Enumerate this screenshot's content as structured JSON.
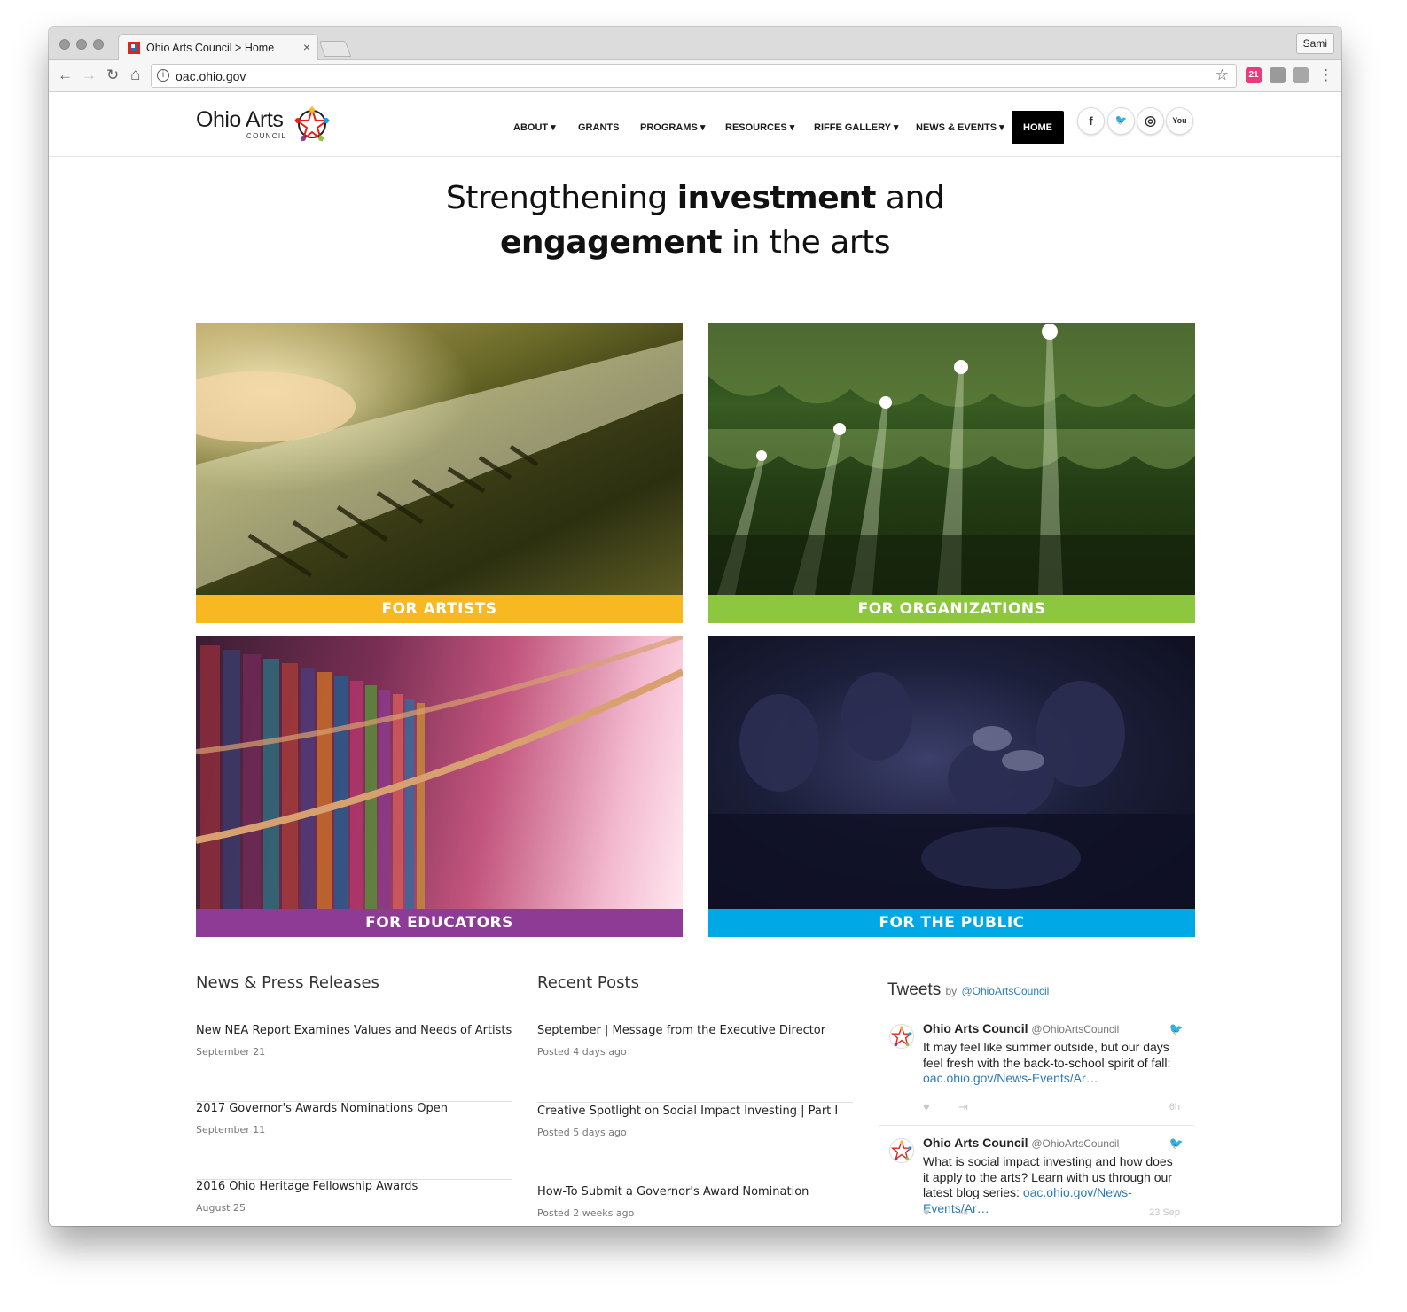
{
  "browser": {
    "tab_title": "Ohio Arts Council > Home",
    "tab_close": "×",
    "profile": "Sami",
    "url": "oac.ohio.gov",
    "back": "←",
    "forward": "→",
    "reload": "↻",
    "home": "⌂",
    "info": "i",
    "star": "☆",
    "menu": "⋮",
    "ext_badge": "21"
  },
  "site": {
    "logo_main": "Ohio Arts",
    "logo_sub": "COUNCIL",
    "nav": [
      {
        "label": "ABOUT ▾"
      },
      {
        "label": "GRANTS"
      },
      {
        "label": "PROGRAMS ▾"
      },
      {
        "label": "RESOURCES ▾"
      },
      {
        "label": "RIFFE GALLERY ▾"
      },
      {
        "label": "NEWS & EVENTS ▾"
      },
      {
        "label": "HOME"
      }
    ],
    "social": {
      "facebook": "f",
      "twitter": "🐦",
      "instagram": "◎",
      "youtube": "You"
    },
    "hero": {
      "line1_a": "Strengthening ",
      "line1_b": "investment",
      "line1_c": " and",
      "line2_a": "engagement",
      "line2_b": " in the arts"
    },
    "tiles": [
      {
        "label": "FOR ARTISTS",
        "color": "#f7b822"
      },
      {
        "label": "FOR ORGANIZATIONS",
        "color": "#8dc63f"
      },
      {
        "label": "FOR EDUCATORS",
        "color": "#8e3b96"
      },
      {
        "label": "FOR THE PUBLIC",
        "color": "#00a9e6"
      }
    ],
    "news": {
      "title": "News & Press Releases",
      "items": [
        {
          "title": "New NEA Report Examines Values and Needs of Artists",
          "date": "September 21"
        },
        {
          "title": "2017 Governor's Awards Nominations Open",
          "date": "September 11"
        },
        {
          "title": "2016 Ohio Heritage Fellowship Awards",
          "date": "August 25"
        }
      ]
    },
    "posts": {
      "title": "Recent Posts",
      "items": [
        {
          "title": "September | Message from the Executive Director",
          "date": "Posted 4 days ago"
        },
        {
          "title": "Creative Spotlight on Social Impact Investing | Part I",
          "date": "Posted 5 days ago"
        },
        {
          "title": "How-To Submit a Governor's Award Nomination",
          "date": "Posted 2 weeks ago"
        }
      ]
    },
    "tweets": {
      "title": "Tweets",
      "by": "by",
      "handle": "@OhioArtsCouncil",
      "items": [
        {
          "name": "Ohio Arts Council",
          "handle": "@OhioArtsCouncil",
          "text": "It may feel like summer outside, but our days feel fresh with the back-to-school spirit of fall: ",
          "link": "oac.ohio.gov/News-Events/Ar…",
          "time": "6h"
        },
        {
          "name": "Ohio Arts Council",
          "handle": "@OhioArtsCouncil",
          "text": "What is social impact investing and how does it apply to the arts? Learn with us through our latest blog series: ",
          "link": "oac.ohio.gov/News-Events/Ar…",
          "time": "23 Sep"
        }
      ],
      "like": "♥",
      "share": "⇥",
      "bird": "🐦"
    }
  }
}
